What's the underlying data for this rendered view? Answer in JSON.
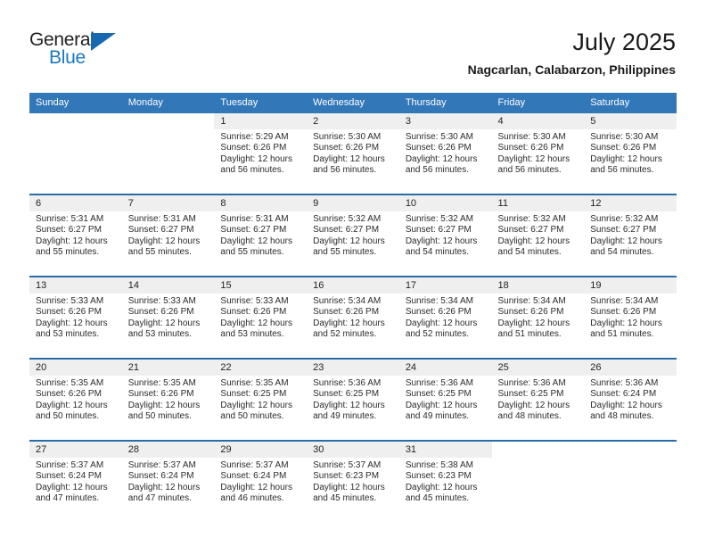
{
  "brand": {
    "word_one": "General",
    "word_two": "Blue",
    "triangle_icon": "triangle-icon",
    "accent_color": "#1668b0"
  },
  "header": {
    "title": "July 2025",
    "location": "Nagcarlan, Calabarzon, Philippines"
  },
  "colors": {
    "header_blue": "#3277b8",
    "row_divider_blue": "#2b6ca8",
    "daynum_band": "#efefef"
  },
  "weekday_headers": [
    "Sunday",
    "Monday",
    "Tuesday",
    "Wednesday",
    "Thursday",
    "Friday",
    "Saturday"
  ],
  "weeks": [
    [
      {
        "day": "",
        "sunrise": "",
        "sunset": "",
        "daylight_line1": "",
        "daylight_line2": "",
        "blank": true
      },
      {
        "day": "",
        "sunrise": "",
        "sunset": "",
        "daylight_line1": "",
        "daylight_line2": "",
        "blank": true
      },
      {
        "day": "1",
        "sunrise": "Sunrise: 5:29 AM",
        "sunset": "Sunset: 6:26 PM",
        "daylight_line1": "Daylight: 12 hours",
        "daylight_line2": "and 56 minutes."
      },
      {
        "day": "2",
        "sunrise": "Sunrise: 5:30 AM",
        "sunset": "Sunset: 6:26 PM",
        "daylight_line1": "Daylight: 12 hours",
        "daylight_line2": "and 56 minutes."
      },
      {
        "day": "3",
        "sunrise": "Sunrise: 5:30 AM",
        "sunset": "Sunset: 6:26 PM",
        "daylight_line1": "Daylight: 12 hours",
        "daylight_line2": "and 56 minutes."
      },
      {
        "day": "4",
        "sunrise": "Sunrise: 5:30 AM",
        "sunset": "Sunset: 6:26 PM",
        "daylight_line1": "Daylight: 12 hours",
        "daylight_line2": "and 56 minutes."
      },
      {
        "day": "5",
        "sunrise": "Sunrise: 5:30 AM",
        "sunset": "Sunset: 6:26 PM",
        "daylight_line1": "Daylight: 12 hours",
        "daylight_line2": "and 56 minutes."
      }
    ],
    [
      {
        "day": "6",
        "sunrise": "Sunrise: 5:31 AM",
        "sunset": "Sunset: 6:27 PM",
        "daylight_line1": "Daylight: 12 hours",
        "daylight_line2": "and 55 minutes."
      },
      {
        "day": "7",
        "sunrise": "Sunrise: 5:31 AM",
        "sunset": "Sunset: 6:27 PM",
        "daylight_line1": "Daylight: 12 hours",
        "daylight_line2": "and 55 minutes."
      },
      {
        "day": "8",
        "sunrise": "Sunrise: 5:31 AM",
        "sunset": "Sunset: 6:27 PM",
        "daylight_line1": "Daylight: 12 hours",
        "daylight_line2": "and 55 minutes."
      },
      {
        "day": "9",
        "sunrise": "Sunrise: 5:32 AM",
        "sunset": "Sunset: 6:27 PM",
        "daylight_line1": "Daylight: 12 hours",
        "daylight_line2": "and 55 minutes."
      },
      {
        "day": "10",
        "sunrise": "Sunrise: 5:32 AM",
        "sunset": "Sunset: 6:27 PM",
        "daylight_line1": "Daylight: 12 hours",
        "daylight_line2": "and 54 minutes."
      },
      {
        "day": "11",
        "sunrise": "Sunrise: 5:32 AM",
        "sunset": "Sunset: 6:27 PM",
        "daylight_line1": "Daylight: 12 hours",
        "daylight_line2": "and 54 minutes."
      },
      {
        "day": "12",
        "sunrise": "Sunrise: 5:32 AM",
        "sunset": "Sunset: 6:27 PM",
        "daylight_line1": "Daylight: 12 hours",
        "daylight_line2": "and 54 minutes."
      }
    ],
    [
      {
        "day": "13",
        "sunrise": "Sunrise: 5:33 AM",
        "sunset": "Sunset: 6:26 PM",
        "daylight_line1": "Daylight: 12 hours",
        "daylight_line2": "and 53 minutes."
      },
      {
        "day": "14",
        "sunrise": "Sunrise: 5:33 AM",
        "sunset": "Sunset: 6:26 PM",
        "daylight_line1": "Daylight: 12 hours",
        "daylight_line2": "and 53 minutes."
      },
      {
        "day": "15",
        "sunrise": "Sunrise: 5:33 AM",
        "sunset": "Sunset: 6:26 PM",
        "daylight_line1": "Daylight: 12 hours",
        "daylight_line2": "and 53 minutes."
      },
      {
        "day": "16",
        "sunrise": "Sunrise: 5:34 AM",
        "sunset": "Sunset: 6:26 PM",
        "daylight_line1": "Daylight: 12 hours",
        "daylight_line2": "and 52 minutes."
      },
      {
        "day": "17",
        "sunrise": "Sunrise: 5:34 AM",
        "sunset": "Sunset: 6:26 PM",
        "daylight_line1": "Daylight: 12 hours",
        "daylight_line2": "and 52 minutes."
      },
      {
        "day": "18",
        "sunrise": "Sunrise: 5:34 AM",
        "sunset": "Sunset: 6:26 PM",
        "daylight_line1": "Daylight: 12 hours",
        "daylight_line2": "and 51 minutes."
      },
      {
        "day": "19",
        "sunrise": "Sunrise: 5:34 AM",
        "sunset": "Sunset: 6:26 PM",
        "daylight_line1": "Daylight: 12 hours",
        "daylight_line2": "and 51 minutes."
      }
    ],
    [
      {
        "day": "20",
        "sunrise": "Sunrise: 5:35 AM",
        "sunset": "Sunset: 6:26 PM",
        "daylight_line1": "Daylight: 12 hours",
        "daylight_line2": "and 50 minutes."
      },
      {
        "day": "21",
        "sunrise": "Sunrise: 5:35 AM",
        "sunset": "Sunset: 6:26 PM",
        "daylight_line1": "Daylight: 12 hours",
        "daylight_line2": "and 50 minutes."
      },
      {
        "day": "22",
        "sunrise": "Sunrise: 5:35 AM",
        "sunset": "Sunset: 6:25 PM",
        "daylight_line1": "Daylight: 12 hours",
        "daylight_line2": "and 50 minutes."
      },
      {
        "day": "23",
        "sunrise": "Sunrise: 5:36 AM",
        "sunset": "Sunset: 6:25 PM",
        "daylight_line1": "Daylight: 12 hours",
        "daylight_line2": "and 49 minutes."
      },
      {
        "day": "24",
        "sunrise": "Sunrise: 5:36 AM",
        "sunset": "Sunset: 6:25 PM",
        "daylight_line1": "Daylight: 12 hours",
        "daylight_line2": "and 49 minutes."
      },
      {
        "day": "25",
        "sunrise": "Sunrise: 5:36 AM",
        "sunset": "Sunset: 6:25 PM",
        "daylight_line1": "Daylight: 12 hours",
        "daylight_line2": "and 48 minutes."
      },
      {
        "day": "26",
        "sunrise": "Sunrise: 5:36 AM",
        "sunset": "Sunset: 6:24 PM",
        "daylight_line1": "Daylight: 12 hours",
        "daylight_line2": "and 48 minutes."
      }
    ],
    [
      {
        "day": "27",
        "sunrise": "Sunrise: 5:37 AM",
        "sunset": "Sunset: 6:24 PM",
        "daylight_line1": "Daylight: 12 hours",
        "daylight_line2": "and 47 minutes."
      },
      {
        "day": "28",
        "sunrise": "Sunrise: 5:37 AM",
        "sunset": "Sunset: 6:24 PM",
        "daylight_line1": "Daylight: 12 hours",
        "daylight_line2": "and 47 minutes."
      },
      {
        "day": "29",
        "sunrise": "Sunrise: 5:37 AM",
        "sunset": "Sunset: 6:24 PM",
        "daylight_line1": "Daylight: 12 hours",
        "daylight_line2": "and 46 minutes."
      },
      {
        "day": "30",
        "sunrise": "Sunrise: 5:37 AM",
        "sunset": "Sunset: 6:23 PM",
        "daylight_line1": "Daylight: 12 hours",
        "daylight_line2": "and 45 minutes."
      },
      {
        "day": "31",
        "sunrise": "Sunrise: 5:38 AM",
        "sunset": "Sunset: 6:23 PM",
        "daylight_line1": "Daylight: 12 hours",
        "daylight_line2": "and 45 minutes."
      },
      {
        "day": "",
        "sunrise": "",
        "sunset": "",
        "daylight_line1": "",
        "daylight_line2": "",
        "blank": true
      },
      {
        "day": "",
        "sunrise": "",
        "sunset": "",
        "daylight_line1": "",
        "daylight_line2": "",
        "blank": true
      }
    ]
  ]
}
